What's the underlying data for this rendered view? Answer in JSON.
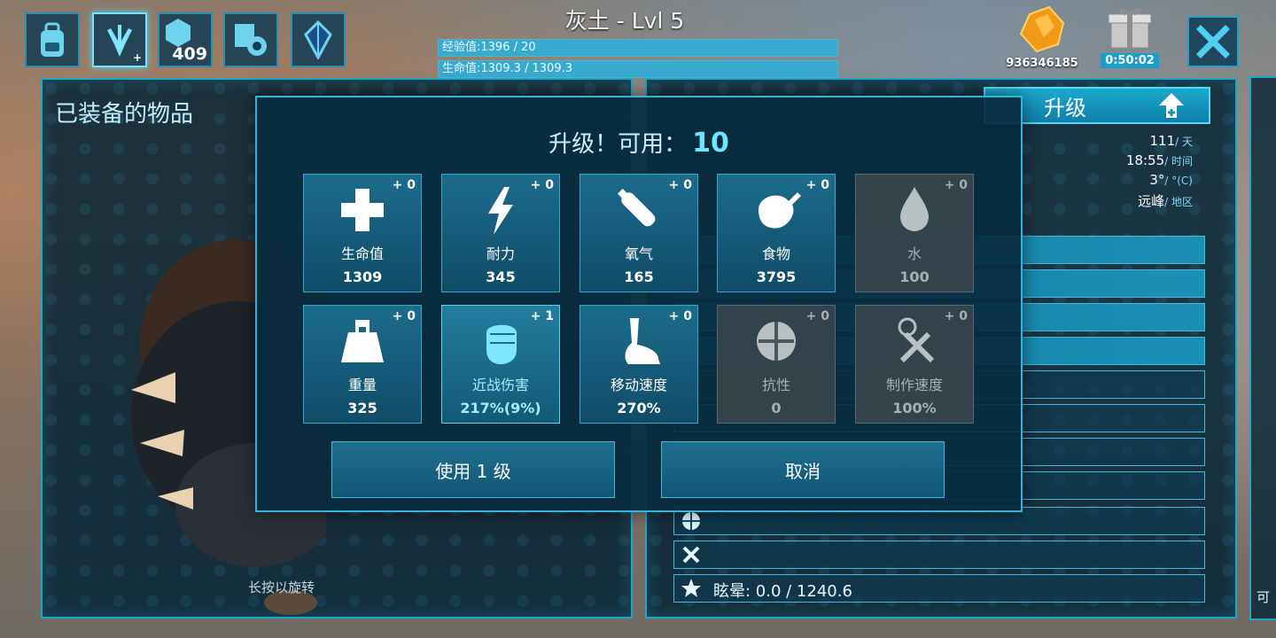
{
  "top": {
    "character_title": "灰土 - Lvl 5",
    "xp_text": "经验值:1396 / 20",
    "xp_fraction": 1.0,
    "health_text": "生命值:1309.3 / 1309.3",
    "health_fraction": 1.0,
    "icons": [
      "backpack-icon",
      "dino-paw-icon",
      "engram-hex-icon",
      "crafting-gear-icon",
      "crystal-icon"
    ],
    "engram_points": "409",
    "currency_amount": "936346185",
    "gift_timer": "0:50:02"
  },
  "left_panel": {
    "title": "已装备的物品",
    "rotate_hint": "长按以旋转"
  },
  "right_panel": {
    "level_up_label": "升级",
    "env": {
      "day_value": "111",
      "day_unit": "/ 天",
      "time_value": "18:55",
      "time_unit": "/ 时间",
      "temp_value": "3°",
      "temp_unit": "/ °(C)",
      "region_value": "远峰",
      "region_unit": "/ 地区"
    },
    "torpor_text": "眩晕: 0.0 / 1240.6"
  },
  "right_edge_label": "可",
  "modal": {
    "title": "升级！可用：",
    "available": "10",
    "stats": [
      {
        "name": "生命值",
        "value": "1309",
        "points": "+ 0",
        "icon": "health-cross-icon",
        "state": "normal"
      },
      {
        "name": "耐力",
        "value": "345",
        "points": "+ 0",
        "icon": "stamina-bolt-icon",
        "state": "normal"
      },
      {
        "name": "氧气",
        "value": "165",
        "points": "+ 0",
        "icon": "oxygen-tank-icon",
        "state": "normal"
      },
      {
        "name": "食物",
        "value": "3795",
        "points": "+ 0",
        "icon": "food-meat-icon",
        "state": "normal"
      },
      {
        "name": "水",
        "value": "100",
        "points": "+ 0",
        "icon": "water-drop-icon",
        "state": "disabled"
      },
      {
        "name": "重量",
        "value": "325",
        "points": "+ 0",
        "icon": "weight-icon",
        "state": "normal"
      },
      {
        "name": "近战伤害",
        "value": "217%(9%)",
        "points": "+ 1",
        "icon": "melee-fist-icon",
        "state": "highlight"
      },
      {
        "name": "移动速度",
        "value": "270%",
        "points": "+ 0",
        "icon": "movement-foot-icon",
        "state": "normal"
      },
      {
        "name": "抗性",
        "value": "0",
        "points": "+ 0",
        "icon": "fortitude-icon",
        "state": "disabled"
      },
      {
        "name": "制作速度",
        "value": "100%",
        "points": "+ 0",
        "icon": "crafting-speed-icon",
        "state": "disabled"
      }
    ],
    "apply_button": "使用 1 级",
    "cancel_button": "取消"
  },
  "colors": {
    "accent": "#1aa9c8",
    "panel": "#06243a",
    "highlight": "#6ee6ff"
  }
}
